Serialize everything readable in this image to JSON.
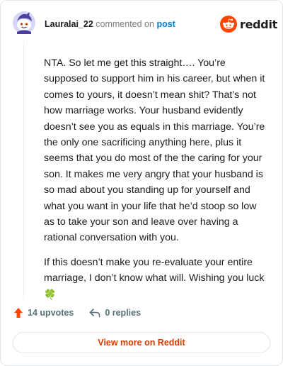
{
  "header": {
    "username": "Lauralai_22",
    "action_text": "commented on",
    "post_link": "post"
  },
  "brand": {
    "wordmark": "reddit",
    "icon": "reddit-snoo-icon",
    "color": "#ff4500"
  },
  "comment": {
    "paragraphs": [
      "NTA. So let me get this straight…. You’re supposed to support him in his career, but when it comes to yours, it doesn’t mean shit? That’s not how marriage works. Your husband evidently doesn’t see you as equals in this marriage. You’re the only one sacrificing anything here, plus it seems that you do most of the the caring for your son. It makes me very angry that your husband is so mad about you standing up for yourself and what you want in your life that he’d stoop so low as to take your son and leave over having a rational conversation with you.",
      "If this doesn’t make you re-evaluate your entire marriage, I don’t know what will. Wishing you luck"
    ],
    "emoji": "🍀"
  },
  "actions": {
    "upvotes": "14 upvotes",
    "replies": "0 replies"
  },
  "footer": {
    "view_more_label": "View more on Reddit"
  },
  "colors": {
    "upvote": "#ff4500",
    "link": "#0079d3",
    "view_more": "#d93a00"
  }
}
